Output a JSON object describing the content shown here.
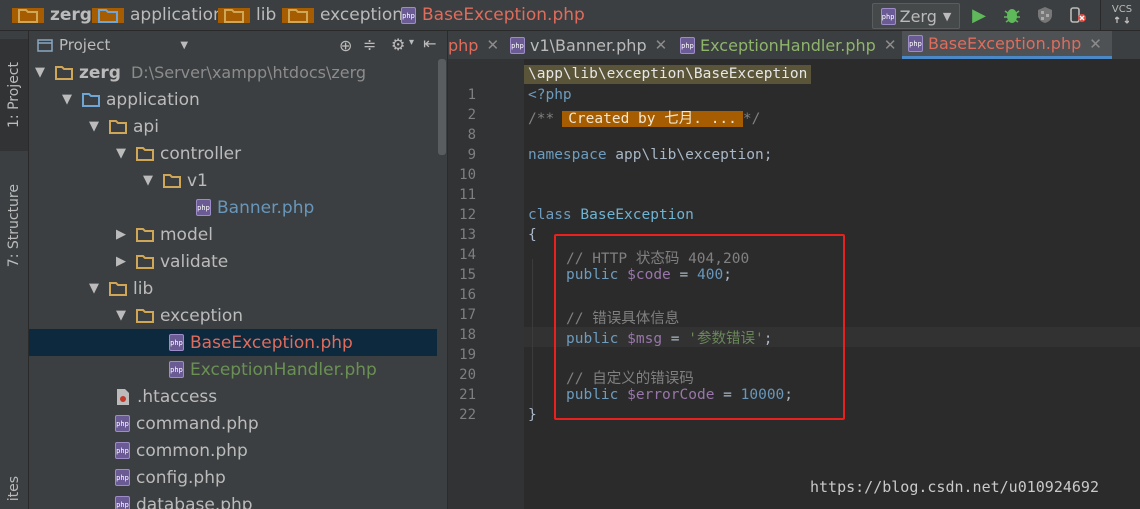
{
  "breadcrumb": [
    "zerg",
    "application",
    "lib",
    "exception",
    "BaseException.php"
  ],
  "run_config": "Zerg",
  "vcs_label": "VCS",
  "left_tabs": {
    "project": "1: Project",
    "structure": "7: Structure",
    "favorites": "ites"
  },
  "project_panel": {
    "title": "Project"
  },
  "tree": [
    {
      "name": "zerg",
      "path": "D:\\Server\\xampp\\htdocs\\zerg",
      "kind": "folder",
      "state": "open",
      "level": 0
    },
    {
      "name": "application",
      "kind": "folder",
      "state": "open",
      "level": 1
    },
    {
      "name": "api",
      "kind": "folder",
      "state": "open",
      "level": 2
    },
    {
      "name": "controller",
      "kind": "folder",
      "state": "open",
      "level": 3
    },
    {
      "name": "v1",
      "kind": "folder",
      "state": "open",
      "level": 4
    },
    {
      "name": "Banner.php",
      "kind": "php",
      "state": "none",
      "level": 5,
      "color": "#6897bb"
    },
    {
      "name": "model",
      "kind": "folder",
      "state": "closed",
      "level": 3
    },
    {
      "name": "validate",
      "kind": "folder",
      "state": "closed",
      "level": 3
    },
    {
      "name": "lib",
      "kind": "folder",
      "state": "open",
      "level": 2
    },
    {
      "name": "exception",
      "kind": "folder",
      "state": "open",
      "level": 3
    },
    {
      "name": "BaseException.php",
      "kind": "php",
      "state": "none",
      "level": 4,
      "color": "#e06c5c",
      "selected": true
    },
    {
      "name": "ExceptionHandler.php",
      "kind": "php",
      "state": "none",
      "level": 4,
      "color": "#6a9153"
    },
    {
      "name": ".htaccess",
      "kind": "file",
      "state": "none",
      "level": 2
    },
    {
      "name": "command.php",
      "kind": "php",
      "state": "none",
      "level": 2
    },
    {
      "name": "common.php",
      "kind": "php",
      "state": "none",
      "level": 2
    },
    {
      "name": "config.php",
      "kind": "php",
      "state": "none",
      "level": 2
    },
    {
      "name": "database.php",
      "kind": "php",
      "state": "none",
      "level": 2
    }
  ],
  "editor_tabs": [
    {
      "label": "php",
      "icon": false,
      "color": "#e06c5c"
    },
    {
      "label": "v1\\Banner.php",
      "icon": true,
      "color": "#bbbbbb"
    },
    {
      "label": "ExceptionHandler.php",
      "icon": true,
      "color": "#8fb56b"
    },
    {
      "label": "BaseException.php",
      "icon": true,
      "color": "#e06c5c",
      "active": true
    }
  ],
  "path_hint": "\\app\\lib\\exception\\BaseException",
  "line_numbers": [
    "1",
    "2",
    "8",
    "9",
    "10",
    "11",
    "12",
    "13",
    "14",
    "15",
    "16",
    "17",
    "18",
    "19",
    "20",
    "21",
    "22"
  ],
  "code": {
    "l1": "<?php",
    "l2_open": "/**",
    "l2_fold": "Created by 七月. ...",
    "l2_close": "*/",
    "l9_kw": "namespace",
    "l9_rest": " app\\lib\\exception;",
    "l12_kw": "class",
    "l12_name": "BaseException",
    "l13": "{",
    "l14": "// HTTP 状态码 404,200",
    "l15_kw": "public",
    "l15_var": "$code",
    "l15_eq": " = ",
    "l15_val": "400",
    "l15_end": ";",
    "l17": "// 错误具体信息",
    "l18_kw": "public",
    "l18_var": "$msg",
    "l18_eq": " = ",
    "l18_val": "'参数错误'",
    "l18_end": ";",
    "l20": "// 自定义的错误码",
    "l21_kw": "public",
    "l21_var": "$errorCode",
    "l21_eq": " = ",
    "l21_val": "10000",
    "l21_end": ";",
    "l22": "}"
  },
  "watermark": "https://blog.csdn.net/u010924692"
}
